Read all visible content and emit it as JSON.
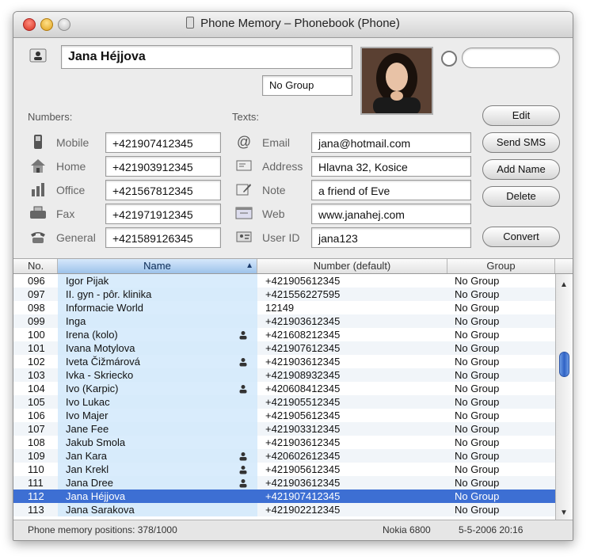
{
  "window": {
    "title": "Phone Memory – Phonebook (Phone)"
  },
  "contact": {
    "name": "Jana Héjjova",
    "group": "No Group",
    "search_value": "",
    "numbers_label": "Numbers:",
    "texts_label": "Texts:",
    "numbers": [
      {
        "label": "Mobile",
        "value": "+421907412345",
        "icon": "mobile-phone-icon"
      },
      {
        "label": "Home",
        "value": "+421903912345",
        "icon": "home-icon"
      },
      {
        "label": "Office",
        "value": "+421567812345",
        "icon": "office-icon"
      },
      {
        "label": "Fax",
        "value": "+421971912345",
        "icon": "fax-icon"
      },
      {
        "label": "General",
        "value": "+421589126345",
        "icon": "general-phone-icon"
      }
    ],
    "texts": [
      {
        "label": "Email",
        "value": "jana@hotmail.com",
        "icon": "email-icon"
      },
      {
        "label": "Address",
        "value": "Hlavna 32, Kosice",
        "icon": "address-icon"
      },
      {
        "label": "Note",
        "value": "a friend of Eve",
        "icon": "note-icon"
      },
      {
        "label": "Web",
        "value": "www.janahej.com",
        "icon": "web-icon"
      },
      {
        "label": "User ID",
        "value": "jana123",
        "icon": "user-id-icon"
      }
    ]
  },
  "buttons": {
    "edit": "Edit",
    "send_sms": "Send SMS",
    "add_name": "Add Name",
    "delete": "Delete",
    "convert": "Convert"
  },
  "table": {
    "columns": {
      "no": "No.",
      "name": "Name",
      "number": "Number (default)",
      "group": "Group"
    },
    "rows": [
      {
        "no": "096",
        "name": "Igor Pijak",
        "number": "+421905612345",
        "group": "No Group",
        "card": false
      },
      {
        "no": "097",
        "name": "II. gyn - pôr. klinika",
        "number": "+421556227595",
        "group": "No Group",
        "card": false
      },
      {
        "no": "098",
        "name": "Informacie World",
        "number": "12149",
        "group": "No Group",
        "card": false
      },
      {
        "no": "099",
        "name": "Inga",
        "number": "+421903612345",
        "group": "No Group",
        "card": false
      },
      {
        "no": "100",
        "name": "Irena (kolo)",
        "number": "+421608212345",
        "group": "No Group",
        "card": true
      },
      {
        "no": "101",
        "name": "Ivana Motylova",
        "number": "+421907612345",
        "group": "No Group",
        "card": false
      },
      {
        "no": "102",
        "name": "Iveta Čižmárová",
        "number": "+421903612345",
        "group": "No Group",
        "card": true
      },
      {
        "no": "103",
        "name": "Ivka - Skriecko",
        "number": "+421908932345",
        "group": "No Group",
        "card": false
      },
      {
        "no": "104",
        "name": "Ivo (Karpic)",
        "number": "+420608412345",
        "group": "No Group",
        "card": true
      },
      {
        "no": "105",
        "name": "Ivo Lukac",
        "number": "+421905512345",
        "group": "No Group",
        "card": false
      },
      {
        "no": "106",
        "name": "Ivo Majer",
        "number": "+421905612345",
        "group": "No Group",
        "card": false
      },
      {
        "no": "107",
        "name": "Jane Fee",
        "number": "+421903312345",
        "group": "No Group",
        "card": false
      },
      {
        "no": "108",
        "name": "Jakub Smola",
        "number": "+421903612345",
        "group": "No Group",
        "card": false
      },
      {
        "no": "109",
        "name": "Jan Kara",
        "number": "+420602612345",
        "group": "No Group",
        "card": true
      },
      {
        "no": "110",
        "name": "Jan Krekl",
        "number": "+421905612345",
        "group": "No Group",
        "card": true
      },
      {
        "no": "111",
        "name": "Jana Dree",
        "number": "+421903612345",
        "group": "No Group",
        "card": true
      },
      {
        "no": "112",
        "name": "Jana Héjjova",
        "number": "+421907412345",
        "group": "No Group",
        "card": false,
        "selected": true
      },
      {
        "no": "113",
        "name": "Jana Sarakova",
        "number": "+421902212345",
        "group": "No Group",
        "card": false
      }
    ]
  },
  "status": {
    "positions": "Phone memory positions:  378/1000",
    "device": "Nokia 6800",
    "datetime": "5-5-2006 20:16"
  }
}
